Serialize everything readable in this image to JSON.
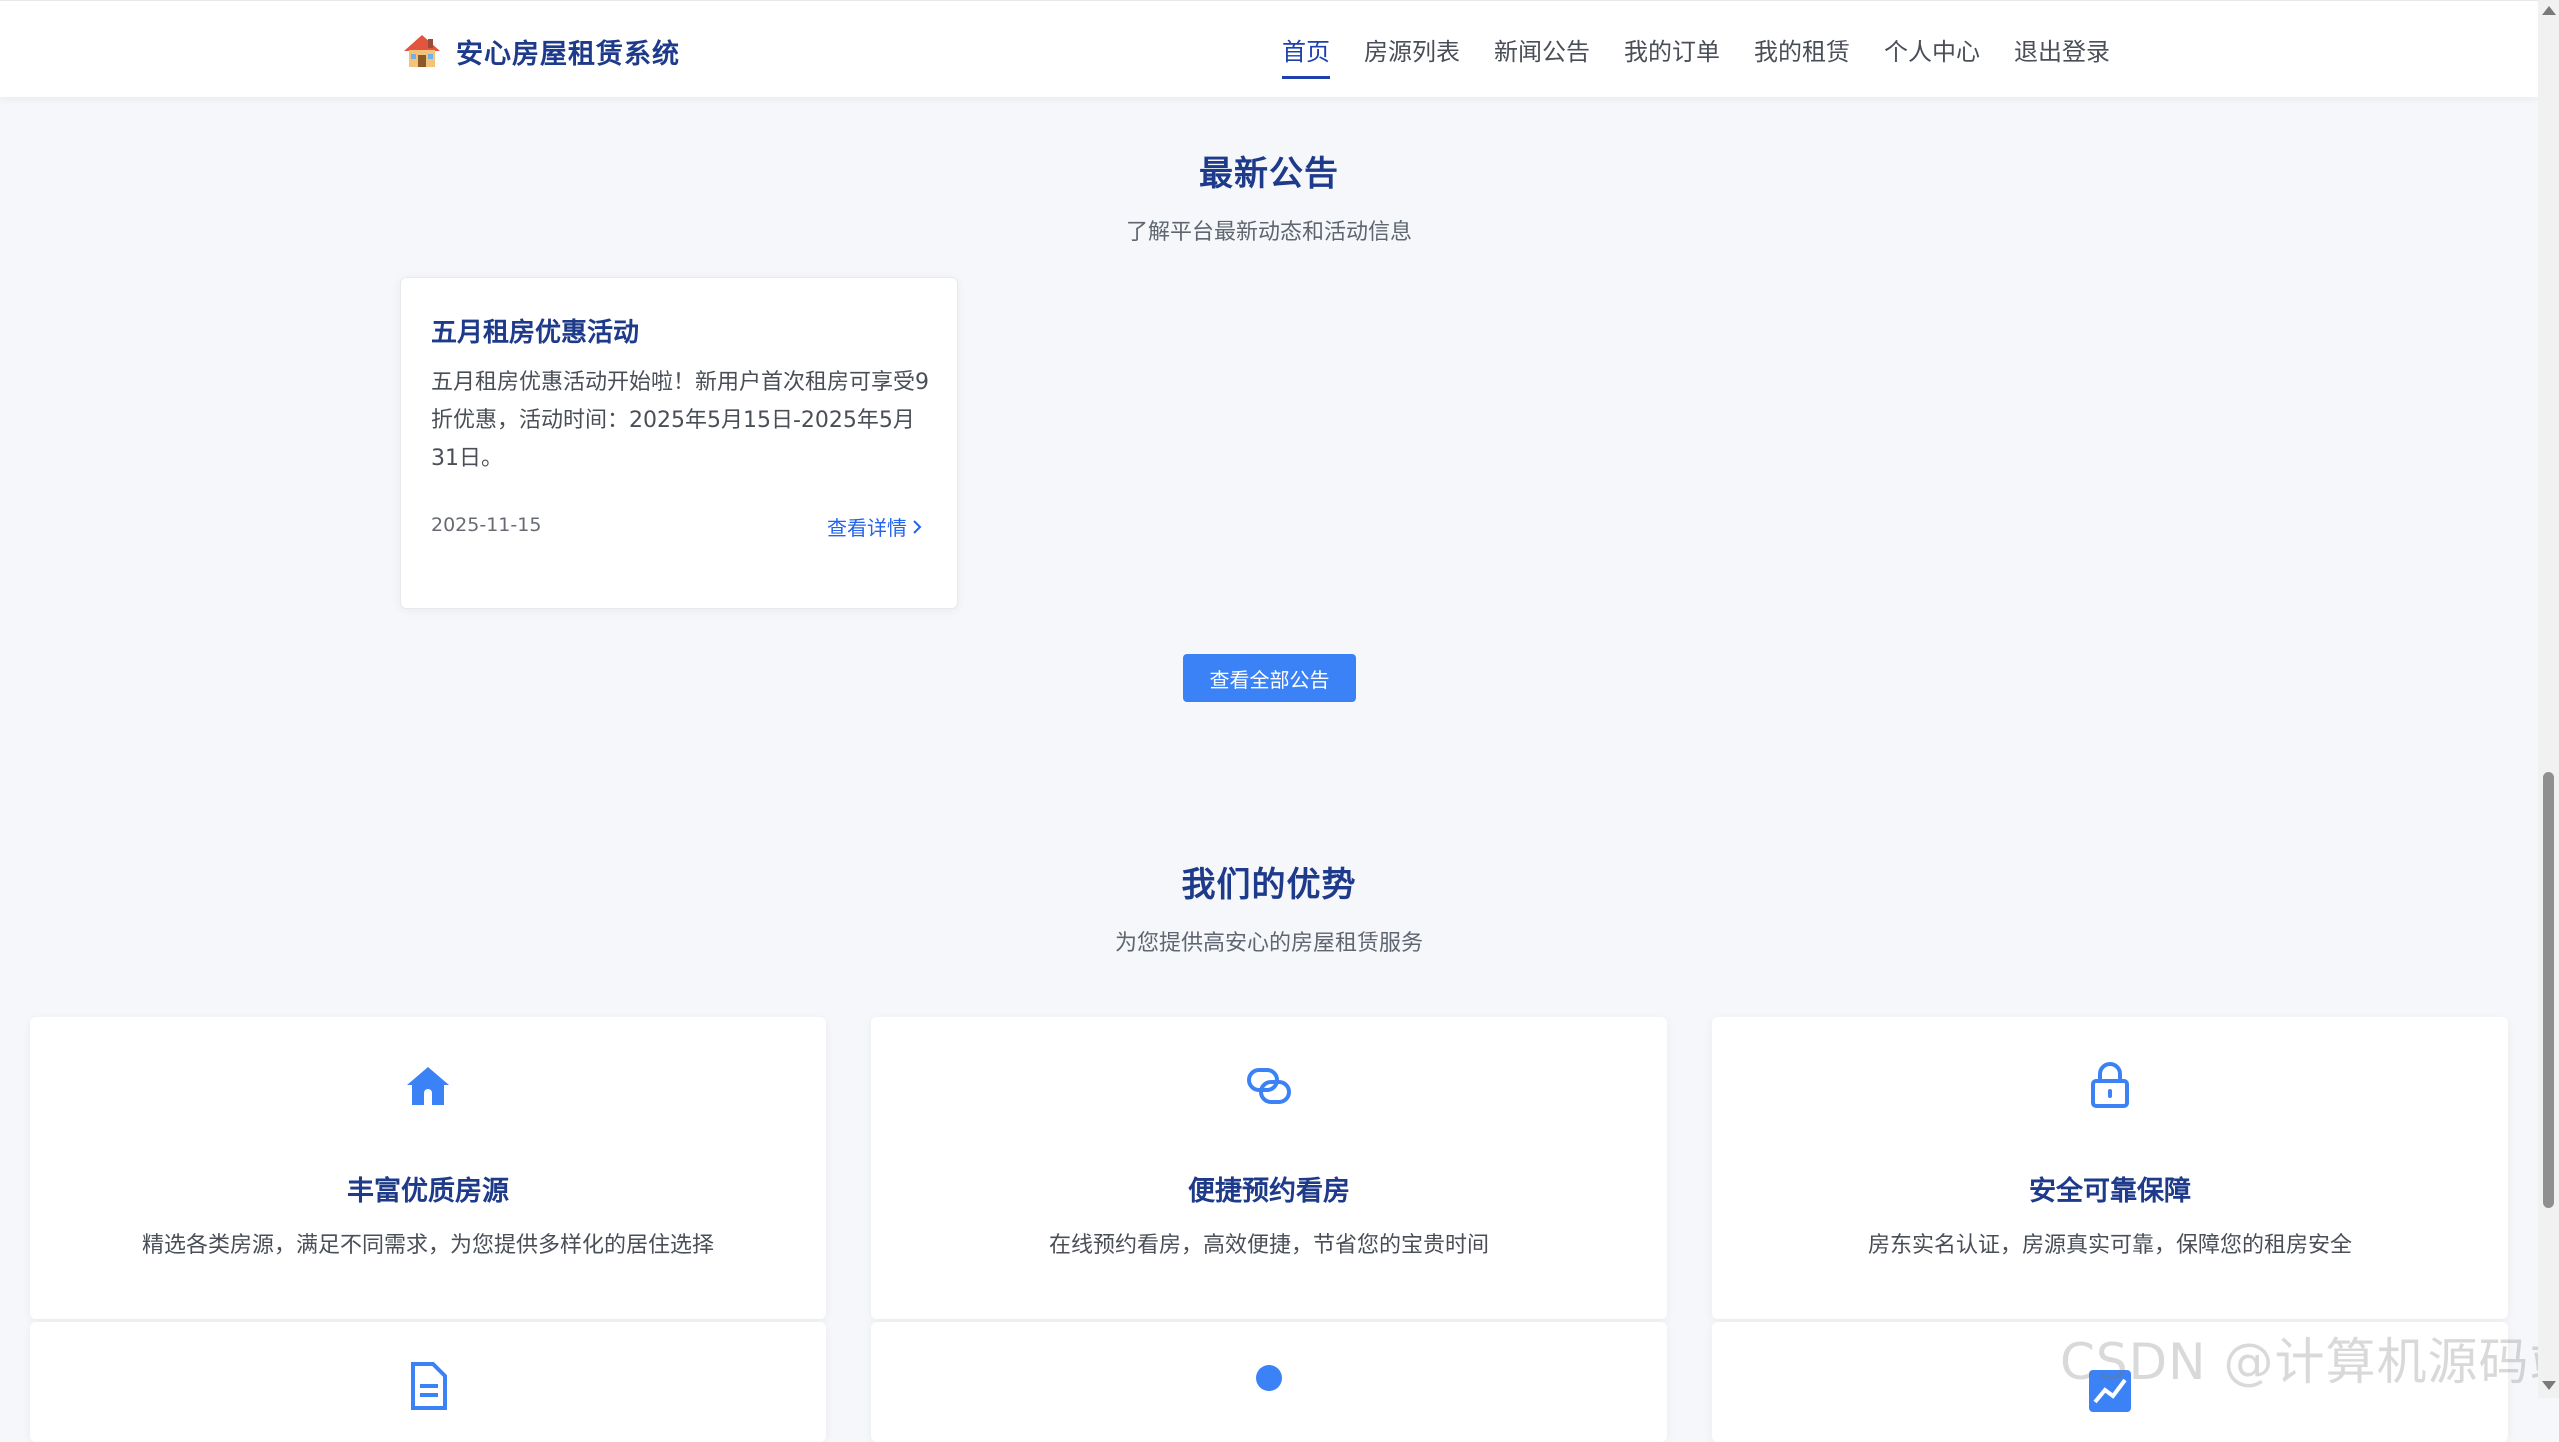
{
  "brand": {
    "title": "安心房屋租赁系统",
    "icon": "house-emoji-icon"
  },
  "nav": {
    "items": [
      {
        "label": "首页",
        "active": true
      },
      {
        "label": "房源列表",
        "active": false
      },
      {
        "label": "新闻公告",
        "active": false
      },
      {
        "label": "我的订单",
        "active": false
      },
      {
        "label": "我的租赁",
        "active": false
      },
      {
        "label": "个人中心",
        "active": false
      },
      {
        "label": "退出登录",
        "active": false
      }
    ]
  },
  "notices": {
    "title": "最新公告",
    "subtitle": "了解平台最新动态和活动信息",
    "items": [
      {
        "title": "五月租房优惠活动",
        "content": "五月租房优惠活动开始啦！新用户首次租房可享受9折优惠，活动时间：2025年5月15日-2025年5月31日。",
        "date": "2025-11-15",
        "link_label": "查看详情"
      }
    ],
    "all_button": "查看全部公告"
  },
  "advantages": {
    "title": "我们的优势",
    "subtitle": "为您提供高安心的房屋租赁服务",
    "items": [
      {
        "icon": "home-icon",
        "title": "丰富优质房源",
        "desc": "精选各类房源，满足不同需求，为您提供多样化的居住选择"
      },
      {
        "icon": "link-icon",
        "title": "便捷预约看房",
        "desc": "在线预约看房，高效便捷，节省您的宝贵时间"
      },
      {
        "icon": "lock-icon",
        "title": "安全可靠保障",
        "desc": "房东实名认证，房源真实可靠，保障您的租房安全"
      },
      {
        "icon": "document-icon",
        "title": "",
        "desc": ""
      },
      {
        "icon": "user-icon",
        "title": "",
        "desc": ""
      },
      {
        "icon": "chart-icon",
        "title": "",
        "desc": ""
      }
    ]
  },
  "watermark": "CSDN @计算机源码站",
  "colors": {
    "primary": "#3b82f6",
    "heading": "#1e3a8a",
    "background": "#f5f7fa"
  }
}
